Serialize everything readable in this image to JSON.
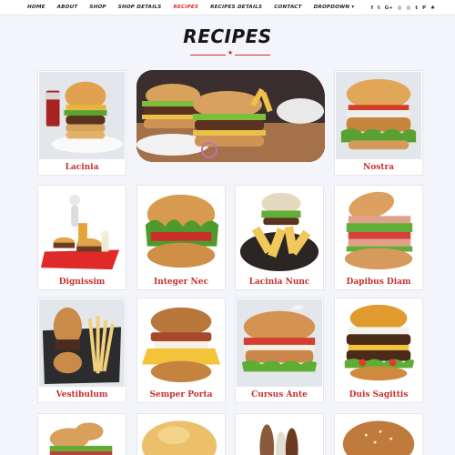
{
  "nav": {
    "items": [
      {
        "label": "HOME",
        "active": false
      },
      {
        "label": "ABOUT",
        "active": false
      },
      {
        "label": "SHOP",
        "active": false
      },
      {
        "label": "SHOP DETAILS",
        "active": false
      },
      {
        "label": "RECIPES",
        "active": true
      },
      {
        "label": "RECIPES DETAILS",
        "active": false
      },
      {
        "label": "CONTACT",
        "active": false
      },
      {
        "label": "DROPDOWN ▾",
        "active": false
      }
    ],
    "social": [
      "f",
      "t",
      "G+",
      "◎",
      "◎",
      "t",
      "P",
      "♣"
    ]
  },
  "page": {
    "heading": "RECIPES",
    "divider_glyph": "★"
  },
  "colors": {
    "accent": "#d52b2b",
    "card_bg": "#ffffff",
    "page_bg": "#f4f5fa"
  },
  "recipes": [
    {
      "title": "Lacinia"
    },
    {
      "title": "Nostra"
    },
    {
      "title": "Dignissim"
    },
    {
      "title": "Integer Nec"
    },
    {
      "title": "Lacinia Nunc"
    },
    {
      "title": "Dapibus Diam"
    },
    {
      "title": "Vestibulum"
    },
    {
      "title": "Semper Porta"
    },
    {
      "title": "Cursus Ante"
    },
    {
      "title": "Duis Sagittis"
    }
  ]
}
